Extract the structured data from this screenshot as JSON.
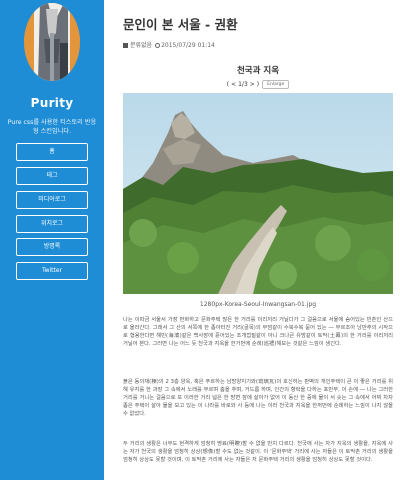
{
  "sidebar": {
    "title": "Purity",
    "description": "Pure css를 사용한 티스토리 반응형 스킨입니다.",
    "nav": [
      "홈",
      "태그",
      "미디어로그",
      "위치로그",
      "방명록",
      "Twitter"
    ]
  },
  "post": {
    "title": "문인이 본 서울 - 권환",
    "category": "분류없음",
    "date": "2015/07/29 01:14",
    "subtitle": "천국과 지옥",
    "pager": {
      "prev": "<",
      "current": "1/3",
      "next": ">",
      "enlarge": "Enlarge"
    },
    "image_caption": "1280px-Korea-Seoul-Inwangsan-01.jpg",
    "paragraphs": [
      "나는 이따금 서울서 가장 번화하고 문화주택 많은 한 거리를 이리저리 거닐다가 그 걸음으로 서울에 숨어있는 빈촌인 산으로 올라간다. 그래서 그 산의 서쪽에 한 좁아터진 거리(골목)의 무덤같이 수북수북 묻어 있는 ― 부르조아 낭만주의 시작으로 형용한다면 해빈(海濱)같은 백사장에 흩어있는 조개껍질같이 아니 크나큰 유방같이 토막(土幕)의 한 거리를 이리저리 거닐어 본다. 그러면 나는 어느 듯 천국과 지옥을 한거번에 순례(巡禮)해보는 것같은 느낌이 생긴다.",
      "붉은 동의채(棟)의 2 3층 양옥, 혹은 푸르하는 남방양지기와(琉璃瓦)의 호신하는 판벽의 개인주택이 큰 이 좋은 거리를 위해 유지를 한 과장 그 속에서 노래를 부르며 춤을 추며, 거드름 하며, 인간의 향락을 다하는 포만부, 이 손에 ― 나는 그러한 거리를 거니는 걸음으로 또 이러한 거리 넓은 한 방면 잠에 살아가 없어 이 동산 한 중에 물이 서 솟는 그 속에서 어찌 차차 좁은 주택이 살아 물을 보고 있는 이 나라를 바로와 사 등에 나는 이러 천국과 지옥을 한꺼번에 순례하는 느낌이 나지 않을 수 없었다.",
      "두 거리의 생활은 너무도 현격하게 엄청히 명료(明瞭)할 수 없을 만치 다르다. 천국에 사는 자가 지옥의 생활을, 지옥에 사는 자가 천국의 생활을 엄청히 상상(想像)할 수도 없는 것같이. 이 '문화주택' 거리에 사는 자들은 이 토막촌 거리의 생활을 엄청히 상상도 못할 것이며, 이 토막촌 거리에 사는 자들은 저 문화주택 거리의 생활을 엄청히 상상도 못할 것이다."
    ]
  }
}
